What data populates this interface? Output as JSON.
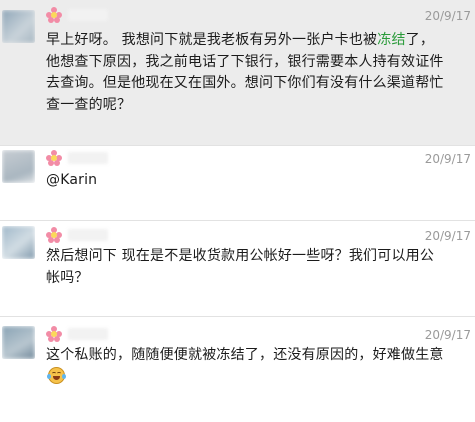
{
  "messages": [
    {
      "time": "20/9/17",
      "text_before": "早上好呀。 我想问下就是我老板有另外一张户卡也被",
      "link": "冻结",
      "text_after": "了，他想查下原因，我之前电话了下银行，银行需要本人持有效证件去查询。但是他现在又在国外。想问下你们有没有什么渠道帮忙查一查的呢？",
      "highlighted": true,
      "avatar_colors": [
        "#8fa6b8",
        "#c9d3da"
      ]
    },
    {
      "time": "20/9/17",
      "text": "@Karin",
      "avatar_colors": [
        "#c7cdd3",
        "#a9b6c0"
      ]
    },
    {
      "time": "20/9/17",
      "text": "然后想问下 现在是不是收货款用公帐好一些呀？我们可以用公帐吗？",
      "avatar_colors": [
        "#9fb7c9",
        "#d2dde4"
      ]
    },
    {
      "time": "20/9/17",
      "text": "这个私账的，随随便便就被冻结了，还没有原因的，好难做生意",
      "emoji": "laughing-crying-emoji",
      "avatar_colors": [
        "#88a2b4",
        "#b9c7d0"
      ]
    }
  ],
  "colors": {
    "highlight_bg": "#ececec",
    "link": "#2a9b3a",
    "time": "#9a9a9a",
    "text": "#1b1b1b"
  }
}
